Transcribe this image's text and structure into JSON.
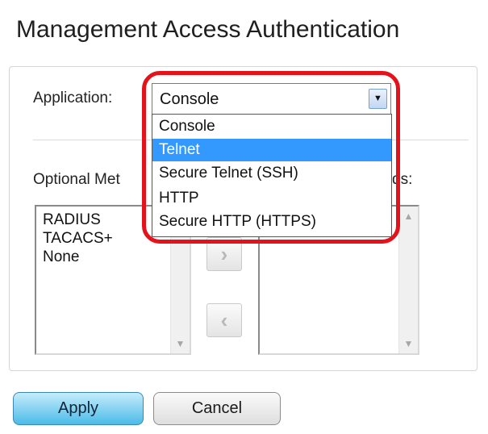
{
  "page": {
    "title": "Management Access Authentication"
  },
  "application": {
    "label": "Application:",
    "selected": "Console",
    "options": [
      "Console",
      "Telnet",
      "Secure Telnet (SSH)",
      "HTTP",
      "Secure HTTP (HTTPS)"
    ],
    "highlighted_option": "Telnet"
  },
  "optional_methods": {
    "label_visible": "Optional Met",
    "items": [
      "RADIUS",
      "TACACS+",
      "None"
    ]
  },
  "selected_methods": {
    "label_visible": "ds:",
    "items": []
  },
  "movers": {
    "right_icon": "chevron-right-icon",
    "left_icon": "chevron-left-icon"
  },
  "buttons": {
    "apply": "Apply",
    "cancel": "Cancel"
  },
  "colors": {
    "highlight_outline": "#e3121b",
    "option_highlight": "#3399ff",
    "apply_button": "#4bbbe8"
  }
}
